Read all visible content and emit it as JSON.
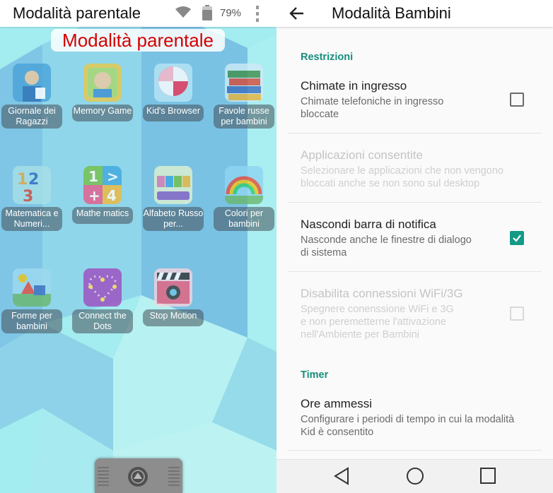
{
  "left": {
    "status": {
      "title": "Modalità parentale",
      "battery": "79%"
    },
    "banner": "Modalità parentale",
    "apps": [
      {
        "label": "Giornale dei Ragazzi",
        "icon": "newspaper-boy-icon",
        "color": "#4aa3d8"
      },
      {
        "label": "Memory Game",
        "icon": "memory-game-icon",
        "color": "#e9c94a"
      },
      {
        "label": "Kid's Browser",
        "icon": "lollipop-icon",
        "color": "#ee3355"
      },
      {
        "label": "Favole russe per bambini",
        "icon": "books-icon",
        "color": "#3f8f4a"
      },
      {
        "label": "Matematica e Numeri...",
        "icon": "numbers-icon",
        "color": "#e8a83a"
      },
      {
        "label": "Mathe matics",
        "icon": "math-icon",
        "color": "#74c045"
      },
      {
        "label": "Alfabeto Russo per...",
        "icon": "alphabet-icon",
        "color": "#e07bb3"
      },
      {
        "label": "Colori per bambini",
        "icon": "rainbow-icon",
        "color": "#5bbde8"
      },
      {
        "label": "Forme per bambini",
        "icon": "shapes-icon",
        "color": "#6bb86c"
      },
      {
        "label": "Connect the Dots",
        "icon": "dots-heart-icon",
        "color": "#9d4cc0"
      },
      {
        "label": "Stop Motion",
        "icon": "clapperboard-icon",
        "color": "#3a3a3a"
      }
    ]
  },
  "right": {
    "appbar_title": "Modalità Bambini",
    "section_restrictions": "Restrizioni",
    "items": [
      {
        "title": "Chimate in ingresso",
        "sub1": "Chimate telefoniche in ingresso",
        "sub2": "bloccate",
        "checked": false
      },
      {
        "title": "Applicazioni consentite",
        "sub1": "Selezionare le applicazioni che non vengono",
        "sub2": "bloccati anche se non sono sul desktop"
      },
      {
        "title": "Nascondi barra di notifica",
        "sub1": "Nasconde anche le finestre di dialogo",
        "sub2": "di sistema",
        "checked": true
      },
      {
        "title": "Disabilita connessioni WiFi/3G",
        "sub1": "Spegnere conenssione WiFi e 3G",
        "sub2": "e non peremetterne l'attivazione",
        "sub3": "nell'Ambiente per Bambini",
        "checked": false
      }
    ],
    "section_timer": "Timer",
    "timer": {
      "title": "Ore ammessi",
      "sub1": "Configurare i periodi di tempo in cui la modalità",
      "sub2": "Kid è consentito"
    }
  },
  "accent": "#139a86"
}
